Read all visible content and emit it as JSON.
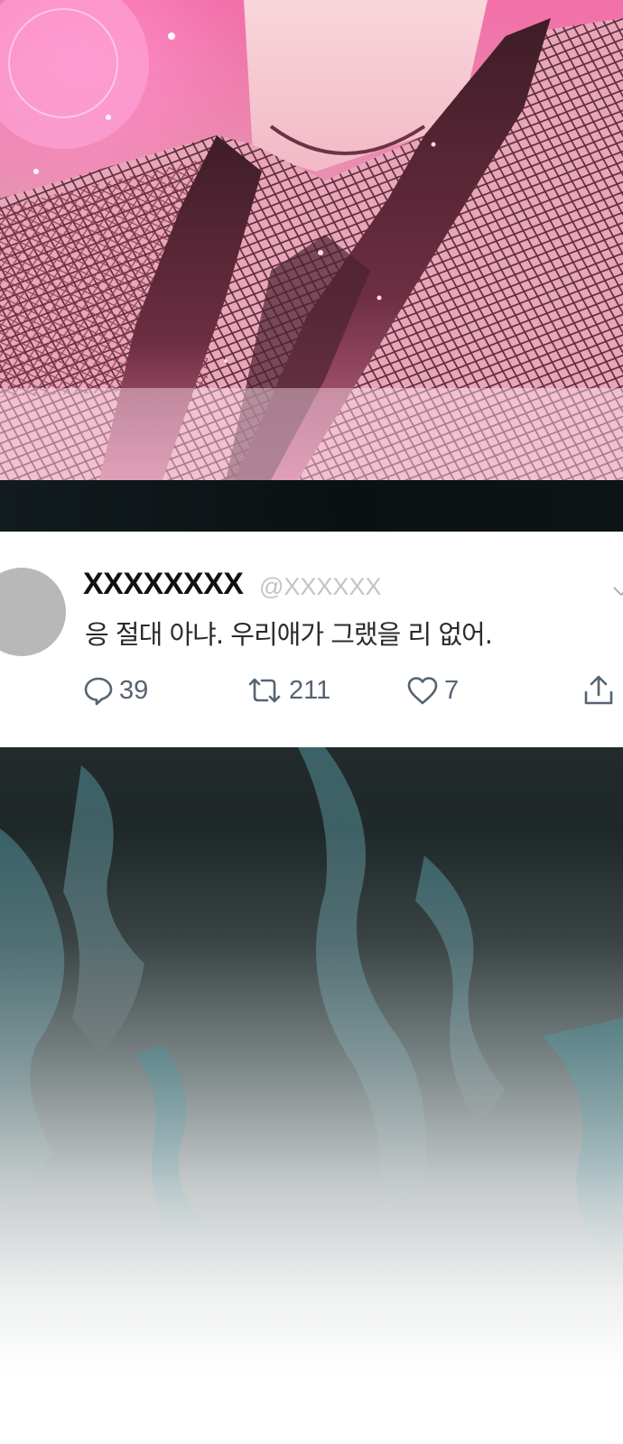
{
  "tweet": {
    "display_name": "XXXXXXXX",
    "handle": "@XXXXXX",
    "text": "응 절대 아냐. 우리애가 그랬을 리 없어.",
    "replies": "39",
    "retweets": "211",
    "likes": "7"
  },
  "icons": {
    "reply": "speech-bubble-icon",
    "retweet": "retweet-arrows-icon",
    "like": "heart-outline-icon",
    "share": "share-upload-icon",
    "menu": "chevron-down-icon"
  },
  "colors": {
    "action_gray": "#566371",
    "handle_gray": "#c4c4c4",
    "avatar_gray": "#b8b8b8",
    "art_pink": "#f26fa8",
    "art_dark": "#0a1113"
  }
}
